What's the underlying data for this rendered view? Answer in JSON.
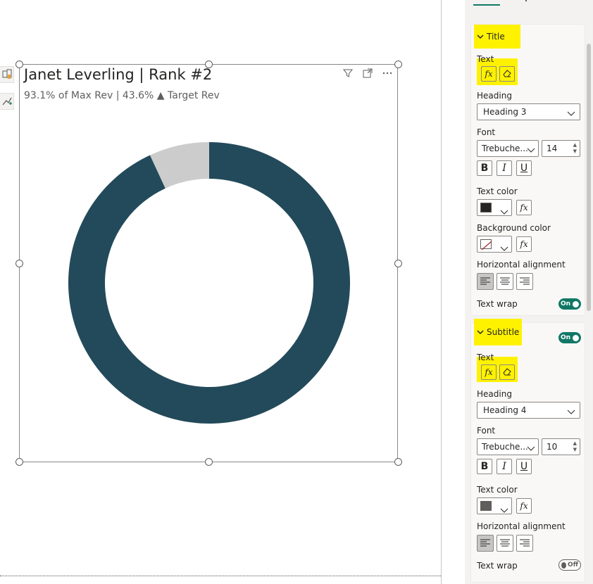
{
  "visual": {
    "title": "Janet Leverling | Rank #2",
    "subtitle": "93.1% of Max Rev | 43.6% ▲ Target Rev",
    "header_icons": [
      "filter-icon",
      "focus-mode-icon",
      "more-options-icon"
    ]
  },
  "side_tools": [
    "format-painter-icon",
    "analytics-icon"
  ],
  "chart_data": {
    "type": "pie",
    "variant": "donut",
    "values": [
      93.1,
      6.9
    ],
    "colors": [
      "#234a5a",
      "#cccccc"
    ]
  },
  "format_pane": {
    "title_card": {
      "header": "Title",
      "text_label": "Text",
      "heading_label": "Heading",
      "heading_value": "Heading 3",
      "font_label": "Font",
      "font_value": "Trebuche...",
      "font_size": "14",
      "bold": "B",
      "italic": "I",
      "underline": "U",
      "text_color_label": "Text color",
      "text_color": "#252423",
      "bg_color_label": "Background color",
      "h_align_label": "Horizontal alignment",
      "text_wrap_label": "Text wrap",
      "text_wrap_value": "On",
      "fx": "fx"
    },
    "subtitle_card": {
      "header": "Subtitle",
      "toggle_value": "On",
      "text_label": "Text",
      "heading_label": "Heading",
      "heading_value": "Heading 4",
      "font_label": "Font",
      "font_value": "Trebuche...",
      "font_size": "10",
      "bold": "B",
      "italic": "I",
      "underline": "U",
      "text_color_label": "Text color",
      "text_color": "#605e5c",
      "h_align_label": "Horizontal alignment",
      "text_wrap_label": "Text wrap",
      "text_wrap_value": "Off",
      "fx": "fx"
    }
  }
}
